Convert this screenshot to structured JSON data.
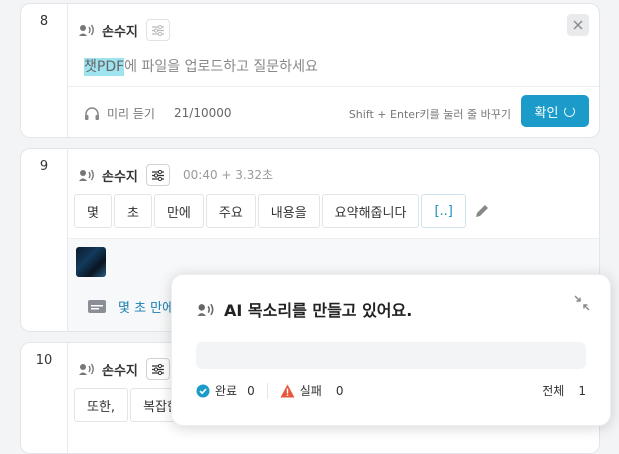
{
  "colors": {
    "accent": "#1a9bc9",
    "highlight": "#9fe3f0",
    "warning": "#e8553e"
  },
  "editor": {
    "number": "8",
    "speaker_name": "손수지",
    "placeholder_highlight": "챗PDF",
    "placeholder_rest": "에 파일을 업로드하고 질문하세요",
    "preview_label": "미리 듣기",
    "char_count": "21/10000",
    "shortcut_hint": "Shift + Enter키를 눌러 줄 바꾸기",
    "confirm_label": "확인"
  },
  "segment9": {
    "number": "9",
    "speaker_name": "손수지",
    "time": "00:40 + 3.32초",
    "tokens": [
      "몇",
      "초",
      "만에",
      "주요",
      "내용을",
      "요약해줍니다",
      "[..]"
    ],
    "summary_text": "몇 초 만에"
  },
  "segment10": {
    "number": "10",
    "speaker_name": "손수지",
    "tokens": [
      "또한,",
      "복잡한"
    ]
  },
  "popup": {
    "title": "AI 목소리를 만들고 있어요.",
    "progress_fraction": 0,
    "done_label": "완료",
    "done_count": "0",
    "fail_label": "실패",
    "fail_count": "0",
    "total_label": "전체",
    "total_count": "1"
  }
}
